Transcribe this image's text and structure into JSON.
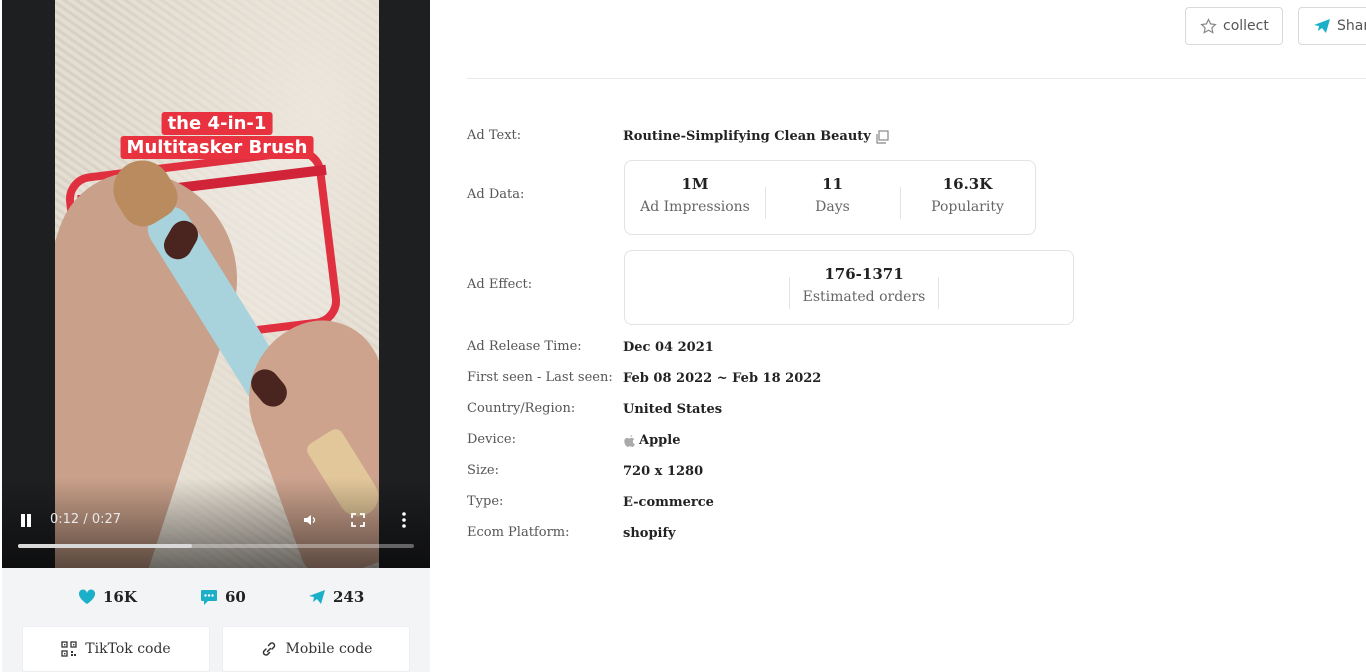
{
  "video": {
    "caption_line1": "the 4-in-1",
    "caption_line2": "Multitasker Brush",
    "time": "0:12 / 0:27",
    "progress": 0.44
  },
  "stats": {
    "likes": "16K",
    "comments": "60",
    "shares": "243"
  },
  "codes": {
    "tiktok_label": "TikTok code",
    "mobile_label": "Mobile code"
  },
  "actions": {
    "collect_label": "collect",
    "share_label": "Share"
  },
  "details": {
    "ad_text_label": "Ad Text:",
    "ad_text_value": "Routine-Simplifying Clean Beauty",
    "ad_data_label": "Ad Data:",
    "ad_data": [
      {
        "value": "1M",
        "caption": "Ad Impressions"
      },
      {
        "value": "11",
        "caption": "Days"
      },
      {
        "value": "16.3K",
        "caption": "Popularity"
      }
    ],
    "ad_effect_label": "Ad Effect:",
    "ad_effect_value": "176-1371",
    "ad_effect_caption": "Estimated orders",
    "release_label": "Ad Release Time:",
    "release_value": "Dec 04 2021",
    "seen_label": "First seen - Last seen:",
    "seen_value": "Feb 08 2022 ~ Feb 18 2022",
    "country_label": "Country/Region:",
    "country_value": "United States",
    "device_label": "Device:",
    "device_value": "Apple",
    "size_label": "Size:",
    "size_value": "720 x 1280",
    "type_label": "Type:",
    "type_value": "E-commerce",
    "platform_label": "Ecom Platform:",
    "platform_value": "shopify"
  },
  "colors": {
    "accent": "#1cb0c8",
    "caption_red": "#e8323f"
  }
}
